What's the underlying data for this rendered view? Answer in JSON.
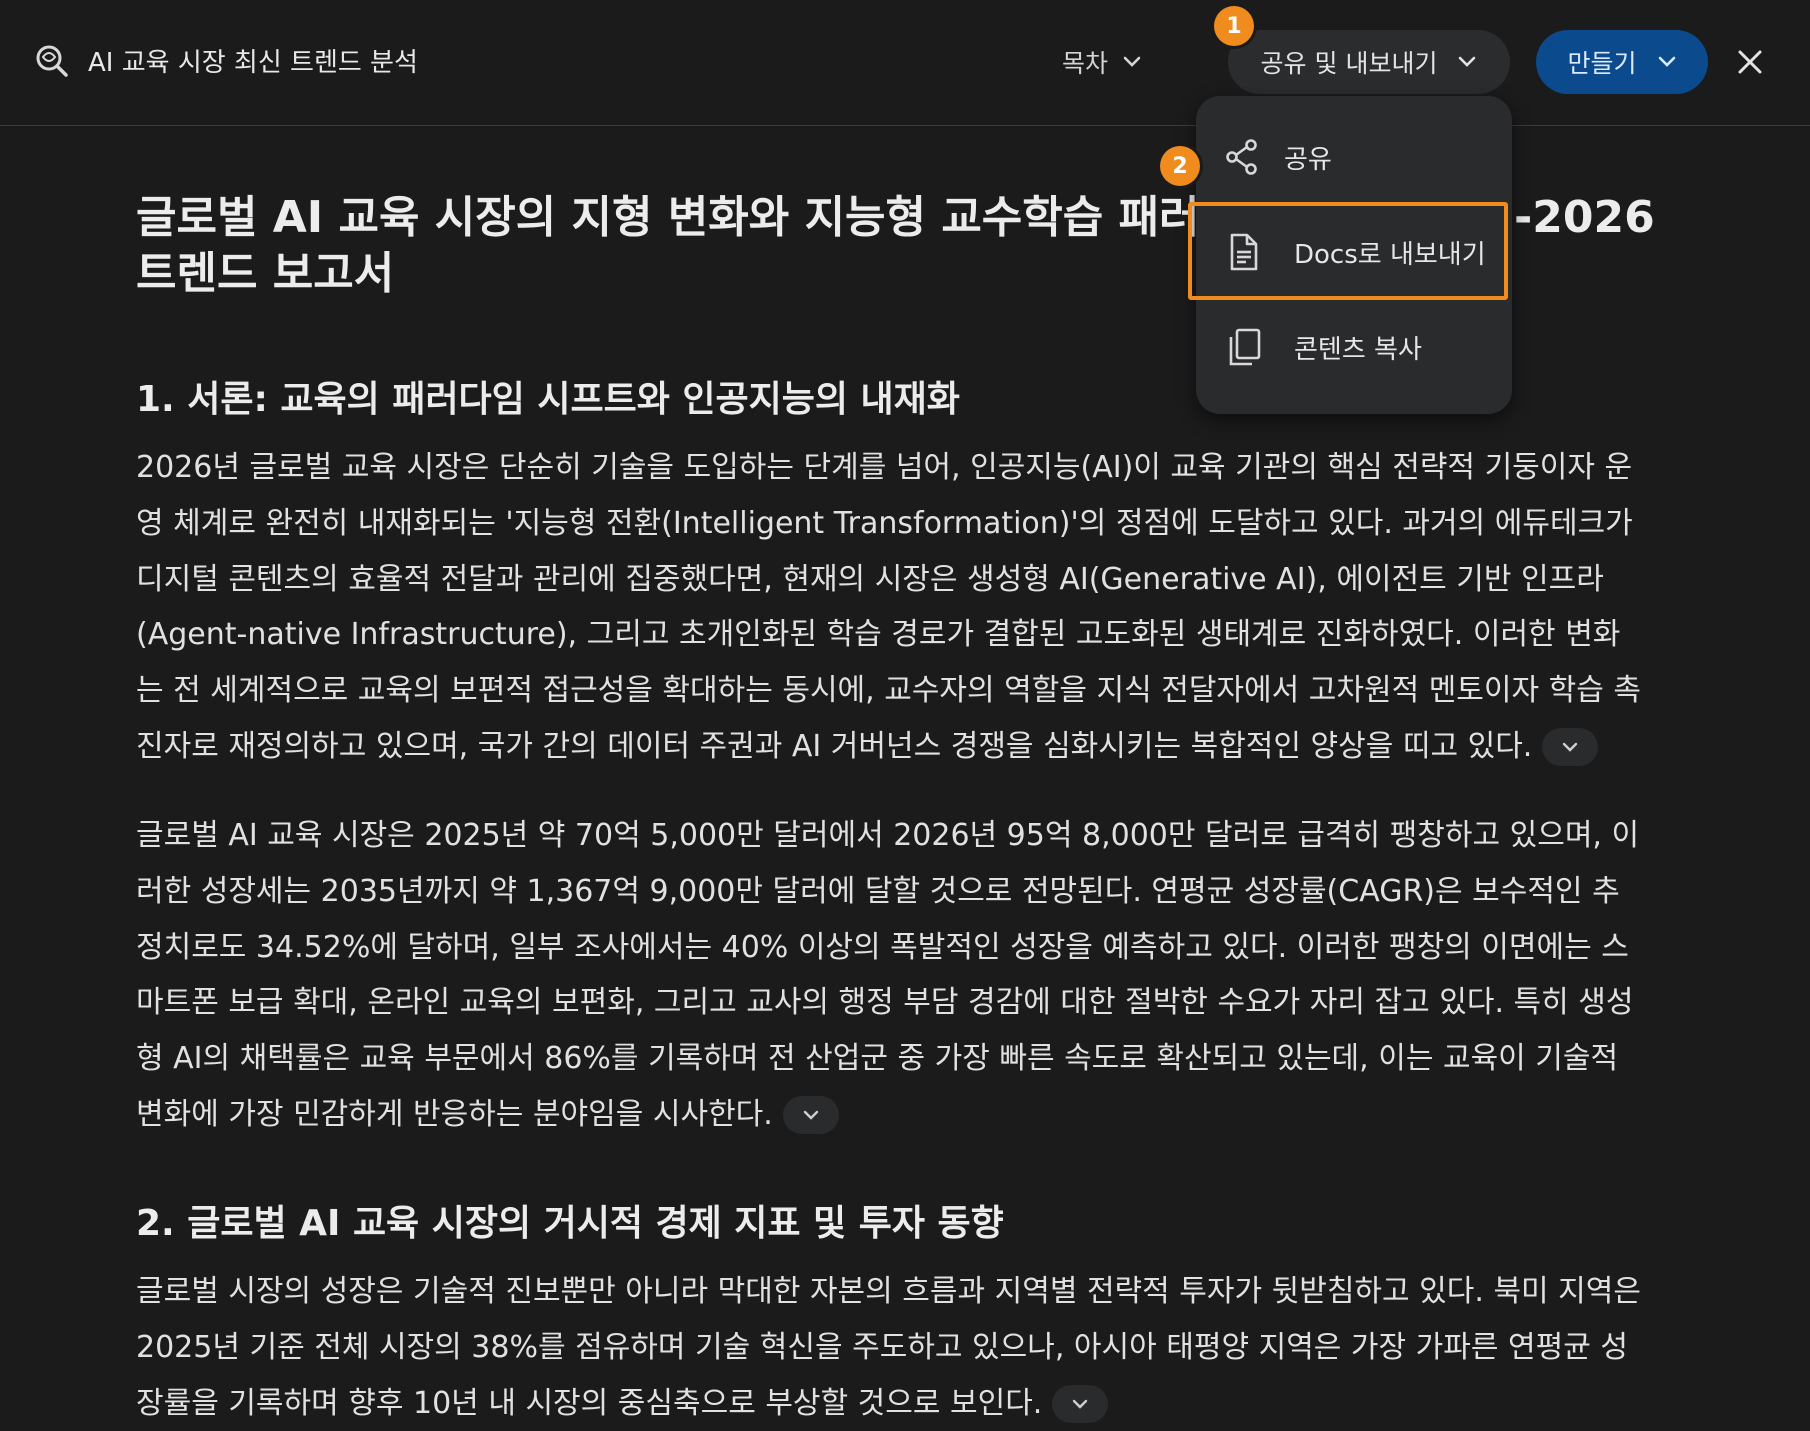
{
  "header": {
    "title": "AI 교육 시장 최신 트렌드 분석",
    "toc_label": "목차",
    "share_export_label": "공유 및 내보내기",
    "create_label": "만들기"
  },
  "badges": {
    "step1": "1",
    "step2": "2"
  },
  "menu": {
    "share": "공유",
    "export_docs": "Docs로 내보내기",
    "copy_content": "콘텐츠 복사"
  },
  "document": {
    "title_line1": "글로벌 AI 교육 시장의 지형 변화와 지능형 교수학습 패러다임의",
    "title_line1_end": "-2026",
    "title_line2": "트렌드 보고서",
    "section1_heading": "1. 서론: 교육의 패러다임 시프트와 인공지능의 내재화",
    "section1_para1": "2026년 글로벌 교육 시장은 단순히 기술을 도입하는 단계를 넘어, 인공지능(AI)이 교육 기관의 핵심 전략적 기둥이자 운영 체계로 완전히 내재화되는 '지능형 전환(Intelligent Transformation)'의 정점에 도달하고 있다. 과거의 에듀테크가 디지털 콘텐츠의 효율적 전달과 관리에 집중했다면, 현재의 시장은 생성형 AI(Generative AI), 에이전트 기반 인프라(Agent-native Infrastructure), 그리고 초개인화된 학습 경로가 결합된 고도화된 생태계로 진화하였다. 이러한 변화는 전 세계적으로 교육의 보편적 접근성을 확대하는 동시에, 교수자의 역할을 지식 전달자에서 고차원적 멘토이자 학습 촉진자로 재정의하고 있으며, 국가 간의 데이터 주권과 AI 거버넌스 경쟁을 심화시키는 복합적인 양상을 띠고 있다.",
    "section1_para2": "글로벌 AI 교육 시장은 2025년 약 70억 5,000만 달러에서 2026년 95억 8,000만 달러로 급격히 팽창하고 있으며, 이러한 성장세는 2035년까지 약 1,367억 9,000만 달러에 달할 것으로 전망된다. 연평균 성장률(CAGR)은 보수적인 추정치로도 34.52%에 달하며, 일부 조사에서는 40% 이상의 폭발적인 성장을 예측하고 있다. 이러한 팽창의 이면에는 스마트폰 보급 확대, 온라인 교육의 보편화, 그리고 교사의 행정 부담 경감에 대한 절박한 수요가 자리 잡고 있다. 특히 생성형 AI의 채택률은 교육 부문에서 86%를 기록하며 전 산업군 중 가장 빠른 속도로 확산되고 있는데, 이는 교육이 기술적 변화에 가장 민감하게 반응하는 분야임을 시사한다.",
    "section2_heading": "2. 글로벌 AI 교육 시장의 거시적 경제 지표 및 투자 동향",
    "section2_para1": "글로벌 시장의 성장은 기술적 진보뿐만 아니라 막대한 자본의 흐름과 지역별 전략적 투자가 뒷받침하고 있다. 북미 지역은 2025년 기준 전체 시장의 38%를 점유하며 기술 혁신을 주도하고 있으나, 아시아 태평양 지역은 가장 가파른 연평균 성장률을 기록하며 향후 10년 내 시장의 중심축으로 부상할 것으로 보인다."
  },
  "colors": {
    "background": "#1b1b1c",
    "accent": "#f08c1e",
    "primary_button": "#0b4a8c"
  }
}
